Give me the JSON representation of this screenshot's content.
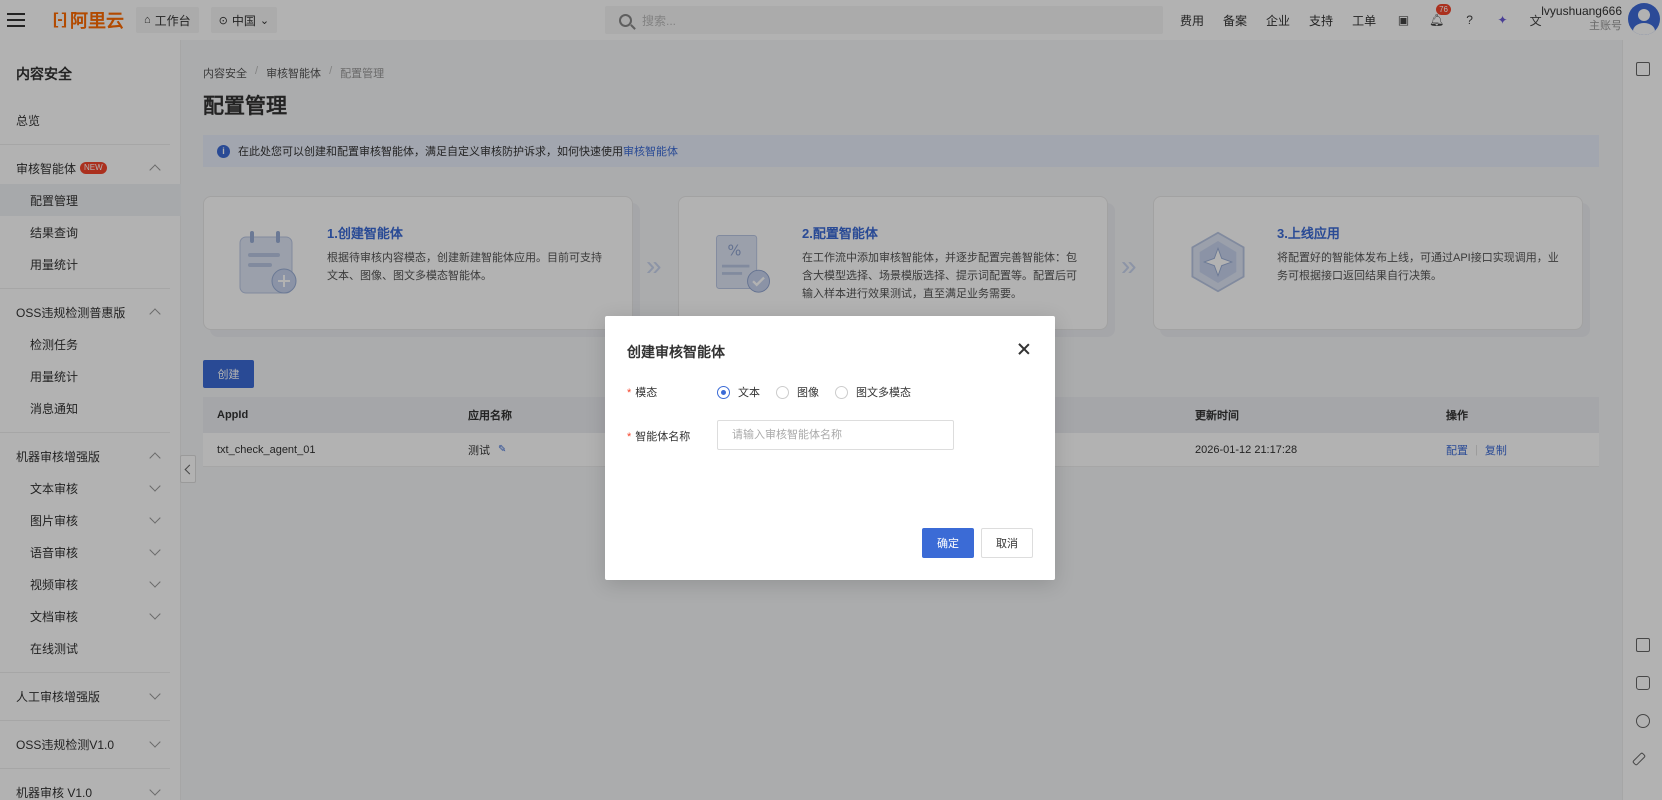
{
  "topbar": {
    "logo_text": "阿里云",
    "workbench": "工作台",
    "region": "中国",
    "search_placeholder": "搜索...",
    "nav": [
      "费用",
      "备案",
      "企业",
      "支持",
      "工单"
    ],
    "notification_count": "76",
    "username": "lvyushuang666",
    "account_type": "主账号"
  },
  "sidebar": {
    "title": "内容安全",
    "overview": "总览",
    "groups": [
      {
        "label": "审核智能体",
        "badge": "NEW",
        "items": [
          "配置管理",
          "结果查询",
          "用量统计"
        ]
      },
      {
        "label": "OSS违规检测普惠版",
        "items": [
          "检测任务",
          "用量统计",
          "消息通知"
        ]
      },
      {
        "label": "机器审核增强版",
        "items": [
          "文本审核",
          "图片审核",
          "语音审核",
          "视频审核",
          "文档审核",
          "在线测试"
        ]
      },
      {
        "label": "人工审核增强版"
      },
      {
        "label": "OSS违规检测V1.0"
      },
      {
        "label": "机器审核 V1.0"
      }
    ]
  },
  "main": {
    "breadcrumb": [
      "内容安全",
      "审核智能体",
      "配置管理"
    ],
    "title": "配置管理",
    "info_text": "在此处您可以创建和配置审核智能体，满足自定义审核防护诉求，如何快速使用",
    "info_link": "审核智能体",
    "steps": [
      {
        "title": "1.创建智能体",
        "desc": "根据待审核内容模态，创建新建智能体应用。目前可支持文本、图像、图文多模态智能体。"
      },
      {
        "title": "2.配置智能体",
        "desc": "在工作流中添加审核智能体，并逐步配置完善智能体：包含大模型选择、场景模版选择、提示词配置等。配置后可输入样本进行效果测试，直至满足业务需要。"
      },
      {
        "title": "3.上线应用",
        "desc": "将配置好的智能体发布上线，可通过API接口实现调用，业务可根据接口返回结果自行决策。"
      }
    ],
    "create_button": "创建",
    "table": {
      "headers": [
        "AppId",
        "应用名称",
        "更新时间",
        "操作"
      ],
      "rows": [
        {
          "appid": "txt_check_agent_01",
          "name": "测试",
          "updated": "2026-01-12 21:17:28",
          "actions": [
            "配置",
            "复制"
          ]
        }
      ]
    }
  },
  "modal": {
    "title": "创建审核智能体",
    "modality_label": "模态",
    "modality_options": [
      "文本",
      "图像",
      "图文多模态"
    ],
    "modality_selected": "文本",
    "name_label": "智能体名称",
    "name_placeholder": "请输入审核智能体名称",
    "ok": "确定",
    "cancel": "取消"
  },
  "colors": {
    "brand": "#ff6a00",
    "primary": "#3b6bd6",
    "badge": "#f5452c"
  }
}
